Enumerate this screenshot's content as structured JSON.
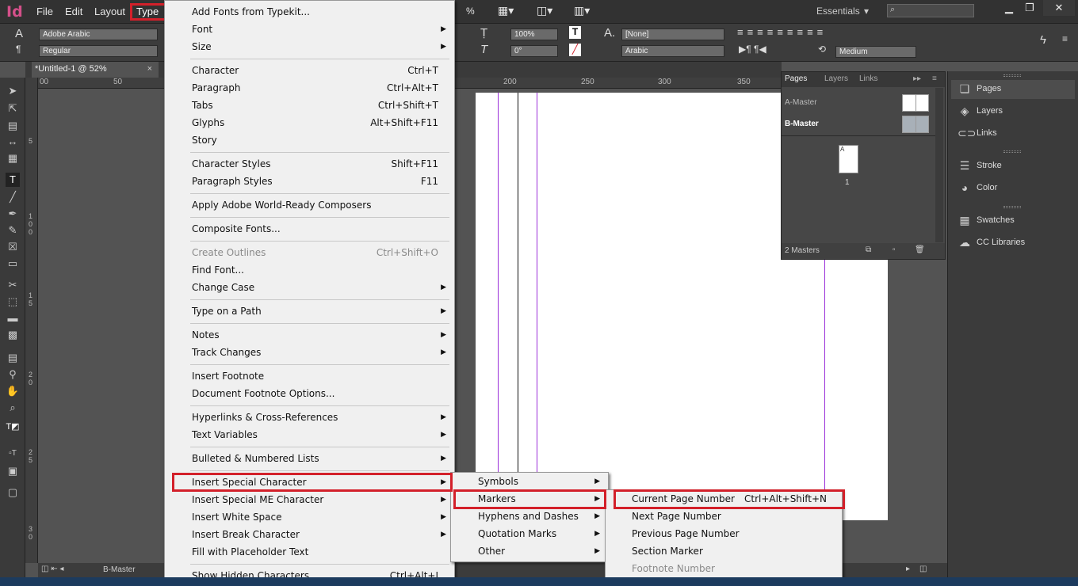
{
  "app": {
    "logo": "Id"
  },
  "menubar": {
    "items": [
      "File",
      "Edit",
      "Layout"
    ],
    "active": "Type",
    "zoom_pct": "%",
    "workspace": "Essentials",
    "win_min": "▁",
    "win_max": "❐",
    "win_close": "✕"
  },
  "control": {
    "font_family": "Adobe Arabic",
    "font_style": "Regular",
    "scale_v": "100%",
    "skew": "0°",
    "char_style": "[None]",
    "language": "Arabic",
    "weight": "Medium"
  },
  "document": {
    "tab_title": "*Untitled-1 @ 52%",
    "close": "×",
    "master_label": "B-Master"
  },
  "ruler": {
    "h_ticks": [
      "00",
      "50",
      "200",
      "250",
      "300",
      "350"
    ],
    "v_ticks": [
      "5",
      "1 0 0",
      "1 5",
      "2 0",
      "2 5",
      "3 0"
    ]
  },
  "type_menu": {
    "items": [
      {
        "label": "Add Fonts from Typekit..."
      },
      {
        "label": "Font",
        "submenu": true
      },
      {
        "label": "Size",
        "submenu": true
      },
      {
        "label": "Character",
        "shortcut": "Ctrl+T"
      },
      {
        "label": "Paragraph",
        "shortcut": "Ctrl+Alt+T"
      },
      {
        "label": "Tabs",
        "shortcut": "Ctrl+Shift+T"
      },
      {
        "label": "Glyphs",
        "shortcut": "Alt+Shift+F11"
      },
      {
        "label": "Story"
      },
      {
        "label": "Character Styles",
        "shortcut": "Shift+F11"
      },
      {
        "label": "Paragraph Styles",
        "shortcut": "F11"
      },
      {
        "label": "Apply Adobe World-Ready Composers"
      },
      {
        "label": "Composite Fonts..."
      },
      {
        "label": "Create Outlines",
        "shortcut": "Ctrl+Shift+O",
        "disabled": true
      },
      {
        "label": "Find Font..."
      },
      {
        "label": "Change Case",
        "submenu": true
      },
      {
        "label": "Type on a Path",
        "submenu": true
      },
      {
        "label": "Notes",
        "submenu": true
      },
      {
        "label": "Track Changes",
        "submenu": true
      },
      {
        "label": "Insert Footnote"
      },
      {
        "label": "Document Footnote Options..."
      },
      {
        "label": "Hyperlinks & Cross-References",
        "submenu": true
      },
      {
        "label": "Text Variables",
        "submenu": true
      },
      {
        "label": "Bulleted & Numbered Lists",
        "submenu": true
      },
      {
        "label": "Insert Special Character",
        "submenu": true
      },
      {
        "label": "Insert Special ME Character",
        "submenu": true
      },
      {
        "label": "Insert White Space",
        "submenu": true
      },
      {
        "label": "Insert Break Character",
        "submenu": true
      },
      {
        "label": "Fill with Placeholder Text"
      },
      {
        "label": "Show Hidden Characters",
        "shortcut": "Ctrl+Alt+I"
      }
    ]
  },
  "special_char_menu": {
    "items": [
      {
        "label": "Symbols"
      },
      {
        "label": "Markers"
      },
      {
        "label": "Hyphens and Dashes"
      },
      {
        "label": "Quotation Marks"
      },
      {
        "label": "Other"
      }
    ]
  },
  "markers_menu": {
    "items": [
      {
        "label": "Current Page Number",
        "shortcut": "Ctrl+Alt+Shift+N"
      },
      {
        "label": "Next Page Number"
      },
      {
        "label": "Previous Page Number"
      },
      {
        "label": "Section Marker"
      },
      {
        "label": "Footnote Number",
        "disabled": true
      }
    ]
  },
  "pages_panel": {
    "tabs": [
      "Pages",
      "Layers",
      "Links"
    ],
    "masters": [
      "A-Master",
      "B-Master"
    ],
    "page_letter": "A",
    "page_number": "1",
    "footer": "2 Masters"
  },
  "dock": {
    "groups": [
      [
        {
          "label": "Pages",
          "icon": "pages-icon"
        },
        {
          "label": "Layers",
          "icon": "layers-icon"
        },
        {
          "label": "Links",
          "icon": "links-icon"
        }
      ],
      [
        {
          "label": "Stroke",
          "icon": "stroke-icon"
        },
        {
          "label": "Color",
          "icon": "color-icon"
        }
      ],
      [
        {
          "label": "Swatches",
          "icon": "swatches-icon"
        },
        {
          "label": "CC Libraries",
          "icon": "cc-libraries-icon"
        }
      ]
    ]
  },
  "colors": {
    "highlight": "#d3202a",
    "logo": "#d4508a",
    "guide": "#9b30d9"
  }
}
